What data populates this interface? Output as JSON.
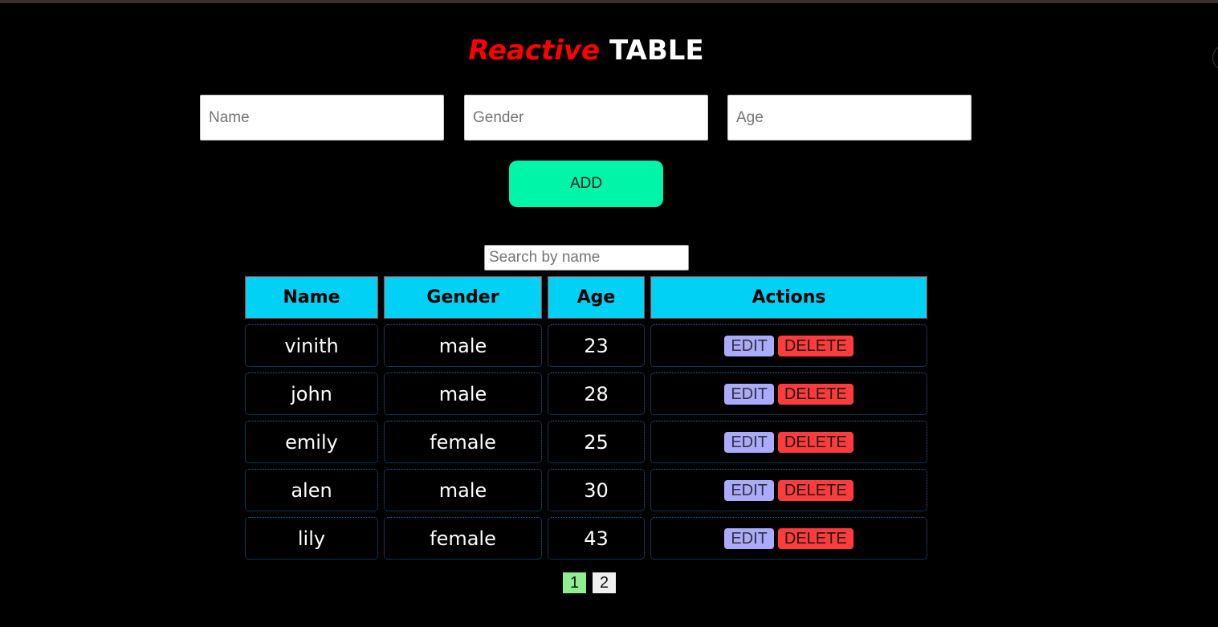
{
  "header": {
    "title_part1": "Reactive",
    "title_part2": "TABLE"
  },
  "form": {
    "name_placeholder": "Name",
    "gender_placeholder": "Gender",
    "age_placeholder": "Age",
    "add_label": "ADD"
  },
  "search": {
    "placeholder": "Search by name"
  },
  "table": {
    "columns": [
      "Name",
      "Gender",
      "Age",
      "Actions"
    ],
    "rows": [
      {
        "name": "vinith",
        "gender": "male",
        "age": "23"
      },
      {
        "name": "john",
        "gender": "male",
        "age": "28"
      },
      {
        "name": "emily",
        "gender": "female",
        "age": "25"
      },
      {
        "name": "alen",
        "gender": "male",
        "age": "30"
      },
      {
        "name": "lily",
        "gender": "female",
        "age": "43"
      }
    ],
    "edit_label": "EDIT",
    "delete_label": "DELETE"
  },
  "pagination": {
    "pages": [
      "1",
      "2"
    ],
    "current": "1"
  },
  "colors": {
    "background": "#000000",
    "title_accent": "#ff0000",
    "add_button": "#00f5a8",
    "header_cell": "#00d1f5",
    "edit_button": "#aaaaff",
    "delete_button": "#ff3b3b",
    "active_page": "#90ee90"
  }
}
